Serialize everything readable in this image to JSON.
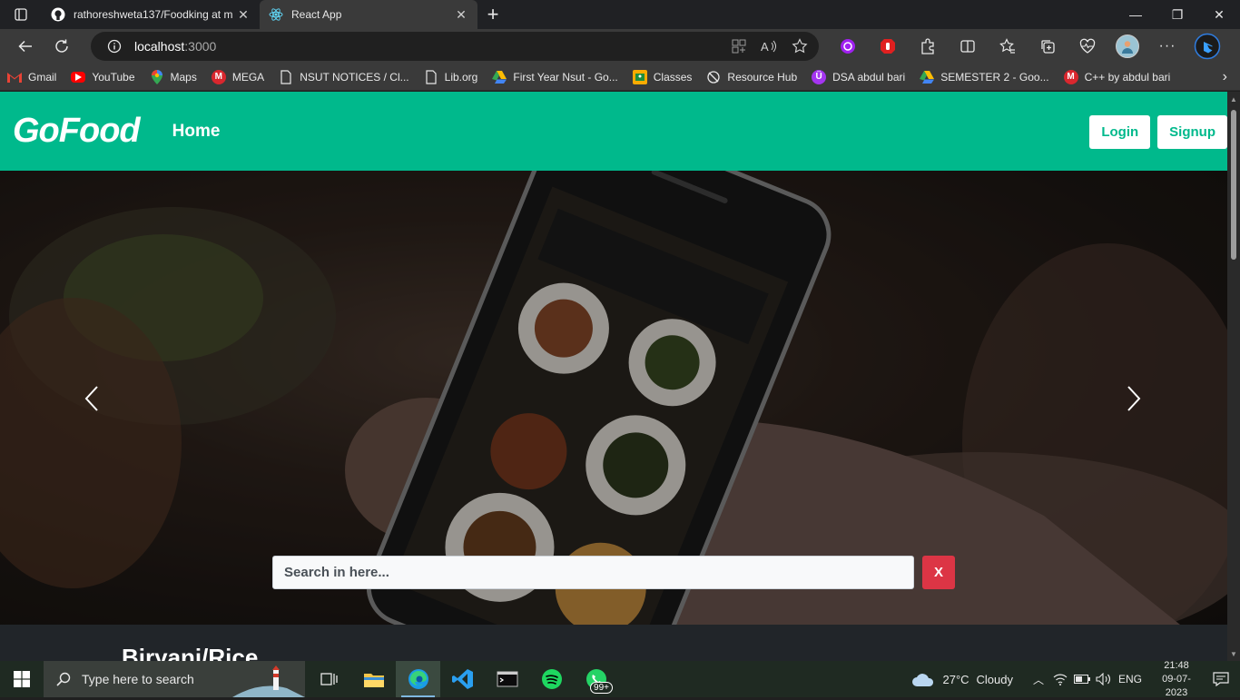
{
  "browser": {
    "tabs": [
      {
        "title": "rathoreshweta137/Foodking at m",
        "icon": "github-icon",
        "active": false
      },
      {
        "title": "React App",
        "icon": "react-icon",
        "active": true
      }
    ],
    "url": {
      "host": "localhost",
      "port": ":3000"
    }
  },
  "bookmarks": [
    {
      "label": "Gmail",
      "icon": "gmail-icon",
      "color": "#d93025"
    },
    {
      "label": "YouTube",
      "icon": "youtube-icon",
      "color": "#ff0000"
    },
    {
      "label": "Maps",
      "icon": "maps-icon",
      "color": "#34a853"
    },
    {
      "label": "MEGA",
      "icon": "mega-icon",
      "color": "#d9272e"
    },
    {
      "label": "NSUT NOTICES / Cl...",
      "icon": "page-icon",
      "color": "#3a3a3a"
    },
    {
      "label": "Lib.org",
      "icon": "page-icon",
      "color": "#3a3a3a"
    },
    {
      "label": "First Year Nsut - Go...",
      "icon": "drive-icon",
      "color": "#fbbc04"
    },
    {
      "label": "Classes",
      "icon": "classroom-icon",
      "color": "#f9ab00"
    },
    {
      "label": "Resource Hub",
      "icon": "resource-hub-icon",
      "color": "#3a3a3a"
    },
    {
      "label": "DSA abdul bari",
      "icon": "udemy-icon",
      "color": "#a435f0"
    },
    {
      "label": "SEMESTER 2 - Goo...",
      "icon": "drive-icon",
      "color": "#fbbc04"
    },
    {
      "label": "C++ by abdul bari",
      "icon": "mega-icon",
      "color": "#d9272e"
    }
  ],
  "app": {
    "brand": "GoFood",
    "nav_home": "Home",
    "login": "Login",
    "signup": "Signup",
    "search_placeholder": "Search in here...",
    "clear": "X",
    "category_title": "Biryani/Rice",
    "accent": "#00b98c",
    "danger": "#dc3545"
  },
  "taskbar": {
    "search_placeholder": "Type here to search",
    "whatsapp_badge": "99+",
    "weather": {
      "temp": "27°C",
      "condition": "Cloudy"
    },
    "language": "ENG",
    "time": "21:48",
    "date": "09-07-2023"
  }
}
